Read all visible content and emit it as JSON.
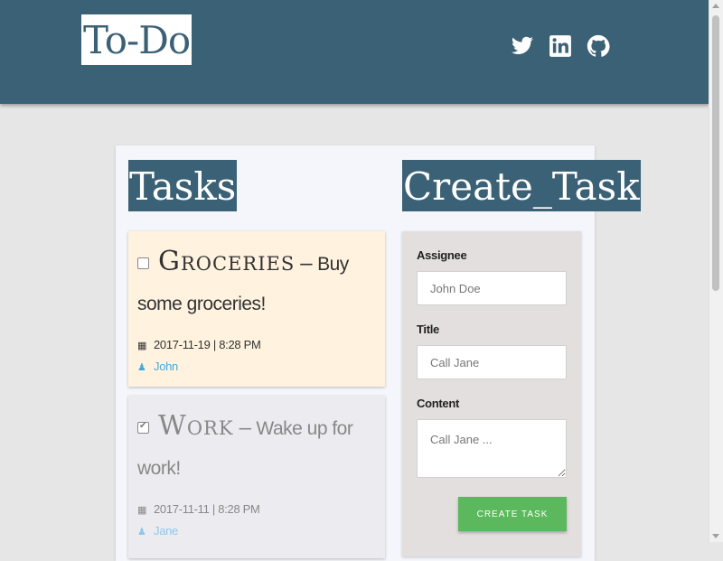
{
  "header": {
    "logo": "To-Do",
    "social": [
      "twitter-icon",
      "linkedin-icon",
      "github-icon"
    ],
    "background_color": "#3b6176"
  },
  "sections": {
    "tasks_title": "Tasks",
    "create_title": "Create_Task"
  },
  "tasks": [
    {
      "title": "Groceries",
      "separator": "–",
      "content": "Buy some groceries!",
      "date": "2017-11-19 | 8:28 PM",
      "assignee": "John",
      "completed": false,
      "background": "#fff3e0"
    },
    {
      "title": "Work",
      "separator": "–",
      "content": "Wake up for work!",
      "date": "2017-11-11 | 8:28 PM",
      "assignee": "Jane",
      "completed": true,
      "background": "#ececf0"
    }
  ],
  "form": {
    "assignee_label": "Assignee",
    "assignee_placeholder": "John Doe",
    "title_label": "Title",
    "title_placeholder": "Call Jane",
    "content_label": "Content",
    "content_placeholder": "Call Jane ...",
    "submit_label": "CREATE TASK",
    "submit_color": "#5cb85c"
  }
}
